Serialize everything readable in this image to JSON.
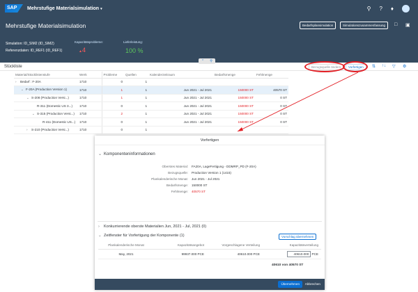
{
  "shell": {
    "logo": "SAP",
    "title": "Mehrstufige Materialsimulation",
    "title_caret": "▾",
    "icons": [
      "search-icon",
      "help-icon",
      "bell-icon",
      "avatar"
    ]
  },
  "header": {
    "title": "Mehrstufige Materialsimulation",
    "btn_bedarf": "Bedarfsplansimulation",
    "btn_summary": "Simulationszusammenfassung",
    "simulation_label": "Simulation:",
    "simulation_value": "ID_SIM2 (ID_SIM2)",
    "referenz_label": "Referenzdaten:",
    "referenz_value": "ID_REF1 (ID_REF1)",
    "kap_label": "Kapazitätsprobleme:",
    "kap_value": "4",
    "lief_label": "Lieferleistung:",
    "lief_value": "100 %"
  },
  "toolbar": {
    "title": "Stückliste",
    "btn_bezug": "Bezugsquelle ändern",
    "btn_vorfertigen": "Vorfertigen"
  },
  "grid": {
    "headers": [
      "Material/Stücklistenstufe",
      "Werk",
      "Probleme",
      "Quellen",
      "Kalenderzeitraum",
      "Bedarfsmenge",
      "Fehlmenge"
    ],
    "rows": [
      {
        "indent": 0,
        "exp": "›",
        "mat": "Bedarf : F-20A",
        "werk": "1710",
        "prob": "0",
        "quell": "1",
        "zeit": "",
        "bedarf": "",
        "fehl": "",
        "probred": false,
        "sel": false
      },
      {
        "indent": 1,
        "exp": "⌄",
        "mat": "F-20A (Production Version 1)",
        "werk": "1710",
        "prob": "1",
        "quell": "1",
        "zeit": "Jun 2021 - Jul 2021",
        "bedarf": "150000 ST",
        "fehl": "40570 ST",
        "probred": true,
        "sel": true
      },
      {
        "indent": 2,
        "exp": "⌄",
        "mat": "S-208 (Production Versi...)",
        "werk": "1710",
        "prob": "1",
        "quell": "1",
        "zeit": "Jun 2021 - Jul 2021",
        "bedarf": "150000 ST",
        "fehl": "0 ST",
        "probred": true,
        "sel": false
      },
      {
        "indent": 3,
        "exp": "",
        "mat": "R-311 (Domestic US 3...)",
        "werk": "1710",
        "prob": "0",
        "quell": "1",
        "zeit": "Jun 2021 - Jul 2021",
        "bedarf": "150000 ST",
        "fehl": "0 ST",
        "probred": false,
        "sel": false
      },
      {
        "indent": 3,
        "exp": "⌄",
        "mat": "S-315 (Production Versi...)",
        "werk": "1710",
        "prob": "2",
        "quell": "1",
        "zeit": "Jun 2021 - Jul 2021",
        "bedarf": "150000 ST",
        "fehl": "0 ST",
        "probred": true,
        "sel": false
      },
      {
        "indent": 4,
        "exp": "",
        "mat": "R-411 (Domestic US...)",
        "werk": "1710",
        "prob": "0",
        "quell": "1",
        "zeit": "Jun 2021 - Jul 2021",
        "bedarf": "150000 ST",
        "fehl": "0 ST",
        "probred": false,
        "sel": false
      },
      {
        "indent": 2,
        "exp": "›",
        "mat": "S-210 (Production Versi...)",
        "werk": "1710",
        "prob": "0",
        "quell": "1",
        "zeit": "",
        "bedarf": "",
        "fehl": "",
        "probred": false,
        "sel": false
      }
    ]
  },
  "dialog": {
    "title": "Vorfertigen",
    "sec1": "Komponenteninformationen",
    "info": [
      {
        "label": "Oberstes Material:",
        "value": "FA20A, LageFertigung - DDMRP_PD (F-20A)",
        "red": false
      },
      {
        "label": "Bezugsquelle:",
        "value": "Production Version 1 (1415)",
        "red": false
      },
      {
        "label": "Plankalenderische Monat:",
        "value": "Jun 2021 - Jul 2021",
        "red": false
      },
      {
        "label": "Bedarfsmenge:",
        "value": "150000 ST",
        "red": false
      },
      {
        "label": "Fehlmenge:",
        "value": "40570 ST",
        "red": true
      }
    ],
    "sec2": "Konkurrierende oberste Materialien Jun, 2021 - Jul, 2021 (0)",
    "sec3": "Zeitfenster für Vorfertigung der Komponente (1)",
    "btn_vorschlag": "Vorschlag übernehmen",
    "table_headers": [
      "Plankalenderische Monat",
      "Kapazitätsangebot",
      "Vorgeschlagene Verteilung",
      "Kapazitätsverteilung"
    ],
    "table_row": {
      "monat": "May, 2021",
      "angebot": "99937.000 PCE",
      "vorschlag": "40610.000 PCE",
      "verteilung": "40610.000",
      "unit": "PCE"
    },
    "total": "40610 von 40570 ST",
    "btn_ok": "Übernehmen",
    "btn_cancel": "Abbrechen"
  }
}
